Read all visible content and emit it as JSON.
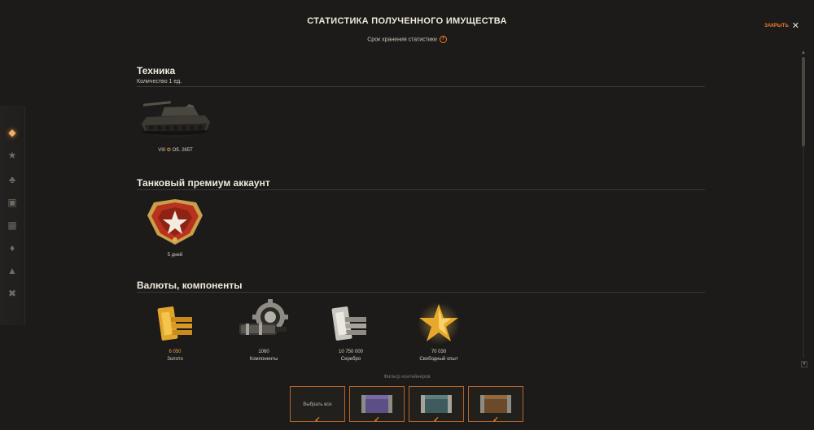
{
  "header": {
    "title": "СТАТИСТИКА ПОЛУЧЕННОГО ИМУЩЕСТВА",
    "subtitle": "Срок хранения статистики",
    "close_label": "ЗАКРЫТЬ"
  },
  "sections": {
    "vehicles": {
      "title": "Техника",
      "count": "Количество 1 ед.",
      "tank_tier": "VIII",
      "tank_name": "Об. 265Т"
    },
    "premium": {
      "title": "Танковый премиум аккаунт",
      "duration": "5 дней"
    },
    "currencies": {
      "title": "Валюты, компоненты",
      "items": [
        {
          "value": "6 050",
          "label": "Золото"
        },
        {
          "value": "1060",
          "label": "Компоненты"
        },
        {
          "value": "10 750 000",
          "label": "Серебро"
        },
        {
          "value": "70 030",
          "label": "Свободный опыт"
        }
      ]
    }
  },
  "filter": {
    "label": "Фильтр контейнеров",
    "select_all": "Выбрать все"
  },
  "colors": {
    "accent": "#f0782a",
    "gold": "#f0a050",
    "background": "#1c1b1a"
  }
}
